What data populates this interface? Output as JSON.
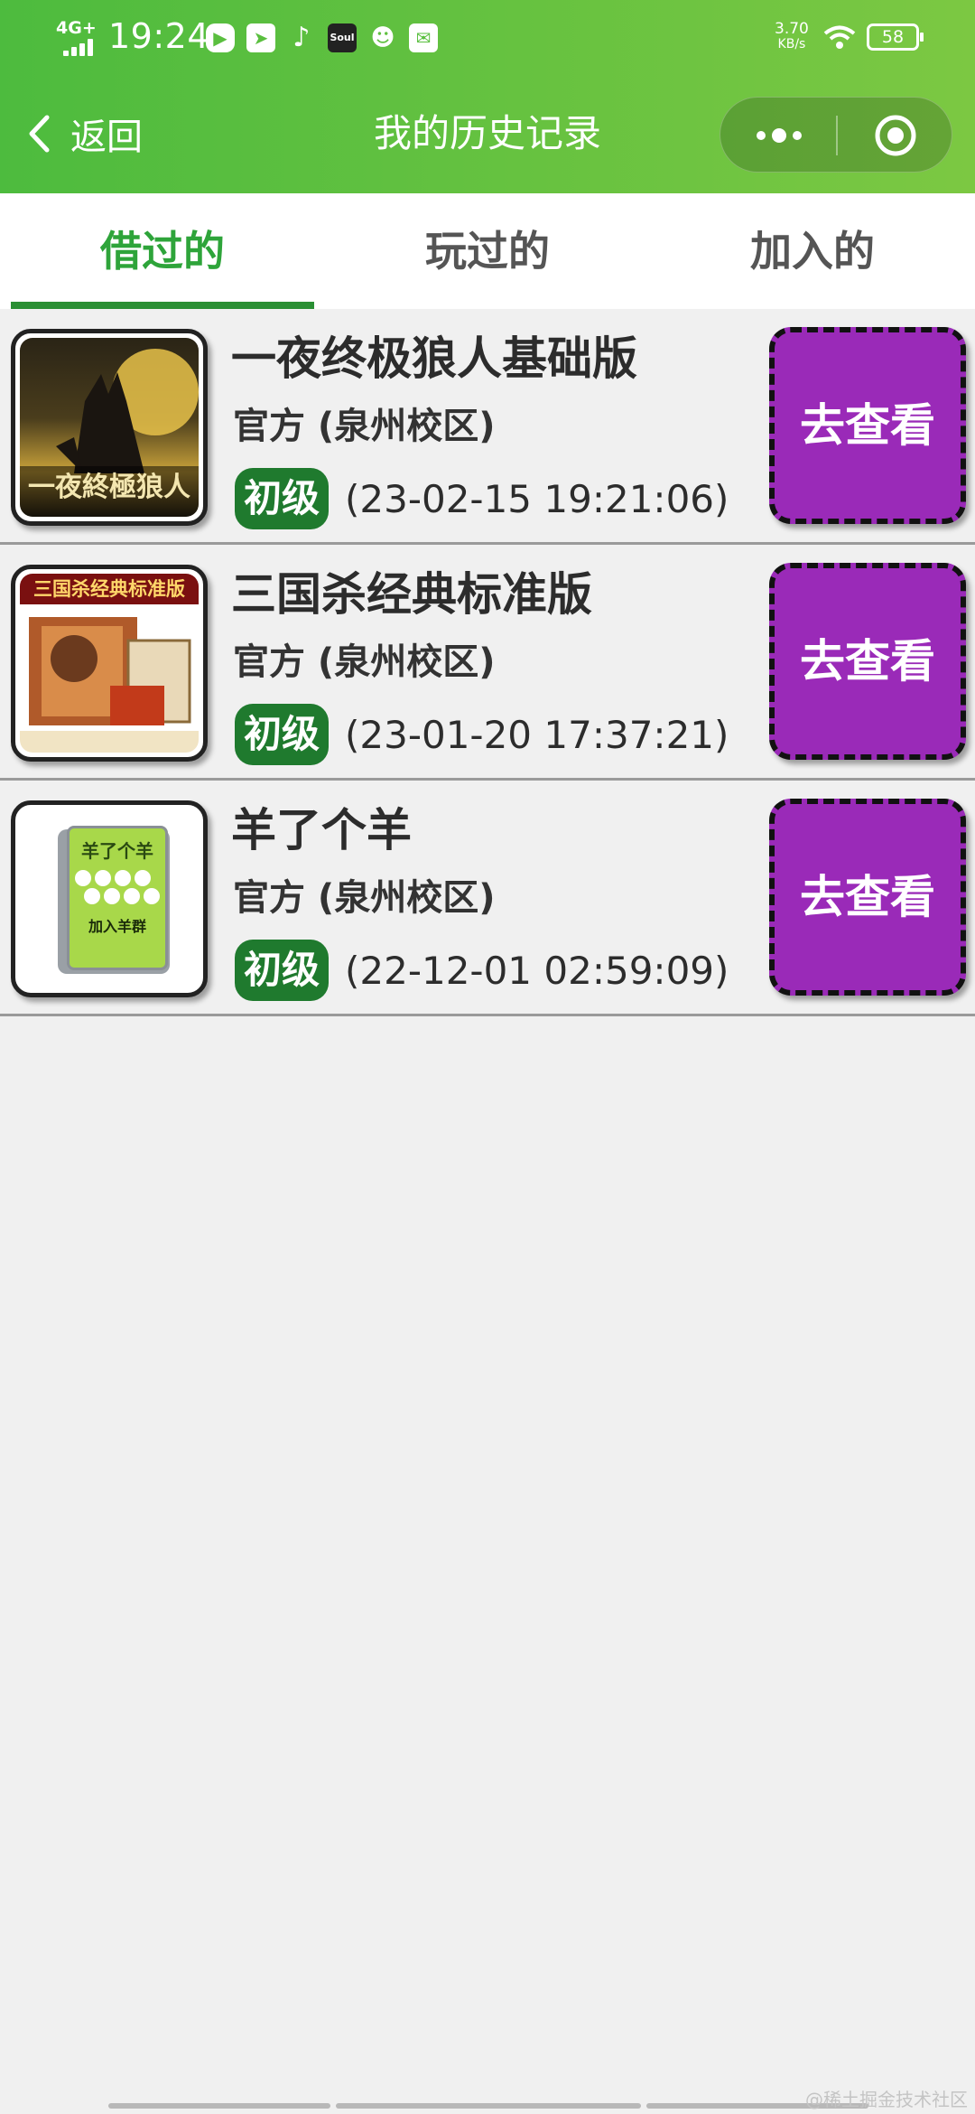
{
  "status_bar": {
    "network": "4G+",
    "time": "19:24",
    "soul_label": "Soul",
    "net_speed_value": "3.70",
    "net_speed_unit": "KB/s",
    "battery": "58"
  },
  "nav": {
    "back_label": "返回",
    "title": "我的历史记录"
  },
  "tabs": [
    {
      "label": "借过的",
      "active": true
    },
    {
      "label": "玩过的",
      "active": false
    },
    {
      "label": "加入的",
      "active": false
    }
  ],
  "records": [
    {
      "name": "一夜终极狼人基础版",
      "location": "官方 (泉州校区)",
      "level": "初级",
      "date": "(23-02-15 19:21:06)",
      "button": "去查看",
      "cover_text": "一夜終極狼人"
    },
    {
      "name": "三国杀经典标准版",
      "location": "官方 (泉州校区)",
      "level": "初级",
      "date": "(23-01-20 17:37:21)",
      "button": "去查看",
      "cover_text": "三国杀经典标准版"
    },
    {
      "name": "羊了个羊",
      "location": "官方 (泉州校区)",
      "level": "初级",
      "date": "(22-12-01 02:59:09)",
      "button": "去查看",
      "cover_text": "羊了个羊",
      "cover_subtext": "加入羊群"
    }
  ],
  "watermark": "@稀土掘金技术社区",
  "colors": {
    "header_start": "#4dbb3e",
    "header_end": "#7cc842",
    "tab_active": "#2ea43a",
    "level_badge": "#1f7a2e",
    "view_button": "#9a2ab8"
  }
}
